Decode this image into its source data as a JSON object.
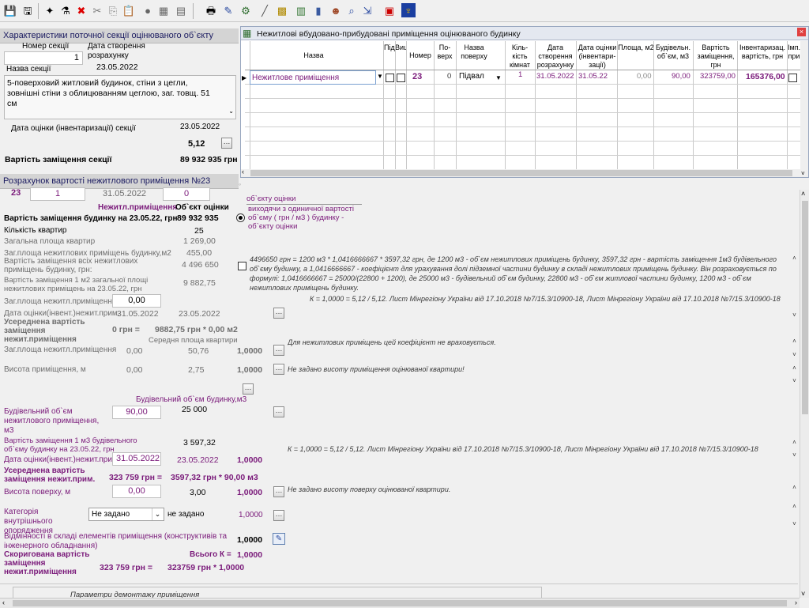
{
  "toolbar": {
    "icons": [
      "save-icon",
      "save-as-icon",
      "new-icon",
      "filter-icon",
      "delete-icon",
      "cut-icon",
      "copy-icon",
      "paste-icon",
      "circle-icon",
      "grid-icon",
      "dots-icon",
      "print-icon",
      "edit-icon",
      "settings-icon",
      "pen-icon",
      "calculator-icon",
      "report-icon",
      "chart-icon",
      "people-icon",
      "search-icon",
      "export-icon",
      "close-icon",
      "emblem-icon"
    ]
  },
  "section": {
    "header": "Характеристики поточної секції оцінюваного об`єкту",
    "number_label": "Номер секції",
    "number_value": "1",
    "name_label": "Назва секції",
    "created_label": "Дата створення розрахунку",
    "created_value": "23.05.2022",
    "description": "5-поверховий житловий будинок, стіни з цегли, зовнішні стіни з облицюванням цеглою, заг. товщ. 51 см",
    "eval_date_label": "Дата оцінки (інвентаризації) секції",
    "eval_date_value": "23.05.2022",
    "coef_value": "5,12",
    "replace_cost_label": "Вартість заміщення секції",
    "replace_cost_value": "89 932 935 грн"
  },
  "calc": {
    "header": "Розрахунок вартості нежитлового приміщення №23",
    "row1": [
      "23",
      "1",
      "31.05.2022",
      "0"
    ],
    "col_nonres": "Нежитл.приміщення",
    "col_object": "Об`єкт оцінки",
    "bld_cost_label": "Вартість заміщення будинку на 23.05.22, грн",
    "bld_cost_value": "89 932 935",
    "apt_count_label": "Кількість квартир",
    "apt_count_value": "25",
    "total_area_label": "Загальна площа квартир",
    "total_area_value": "1 269,00",
    "nonres_area_label": "Заг.площа нежитлових приміщень будинку,м2",
    "nonres_area_value": "455,00",
    "nonres_cost_label": "Вартість заміщення всіх нежитлових приміщень будинку, грн:",
    "nonres_cost_value": "4 496 650",
    "m2_cost_label": "Вартість заміщення 1 м2 загальної площі нежитлових приміщень на 23.05.22, грн",
    "m2_cost_value": "9 882,75",
    "area_label": "Заг.площа нежитл.приміщення",
    "area_value": "0,00",
    "date_label": "Дата оцінки(інвент.)нежит.прим.",
    "date_a": "31.05.2022",
    "date_b": "23.05.2022",
    "avg_label": "Усереднена вартість заміщення нежит.приміщення",
    "avg_left": "0 грн =",
    "avg_formula": "9882,75 грн * 0,00 м2",
    "avg_apt_label": "Середня площа квартири",
    "area2_label": "Заг.площа нежитл.приміщення",
    "area2_a": "0,00",
    "area2_b": "50,76",
    "area2_k": "1,0000",
    "height_label": "Висота приміщення, м",
    "height_a": "0,00",
    "height_b": "2,75",
    "height_k": "1,0000",
    "bld_volume_label": "Будівельний об`єм будинку,м3",
    "bld_volume_value": "25 000",
    "room_volume_label": "Будівельний об`єм нежитлового приміщення, м3",
    "room_volume_value": "90,00",
    "m3_cost_label": "Вартість заміщення 1 м3 будівельного об`єму будинку на 23.05.22, грн",
    "m3_cost_value": "3 597,32",
    "date2_label": "Дата оцінки(інвент.)нежит.прим.",
    "date2_a": "31.05.2022",
    "date2_b": "23.05.2022",
    "date2_k": "1,0000",
    "avg2_label": "Усереднена вартість заміщення нежит.прим.",
    "avg2_left": "323 759 грн =",
    "avg2_formula": "3597,32 грн * 90,00 м3",
    "floor_label": "Висота поверху, м",
    "floor_a": "0,00",
    "floor_b": "3,00",
    "floor_k": "1,0000",
    "cat_label": "Категорія внутрішнього опорядження",
    "cat_value": "Не задано",
    "cat_b": "не задано",
    "cat_k": "1,0000",
    "diff_label": "Відмінності в складі елементів приміщення (конструктивів та інженерного обладнання)",
    "diff_k": "1,0000",
    "total_k_label": "Всього К =",
    "total_k_value": "1,0000",
    "adj_label": "Скоригована вартість заміщення нежит.приміщення",
    "adj_left": "323 759 грн =",
    "adj_formula": "323759 грн * 1,0000",
    "bottom_label": "Параметри  демонтажу  приміщення"
  },
  "table": {
    "title": "Нежитлові вбудовано-прибудовані приміщення оцінюваного будинку",
    "columns": [
      "Назва",
      "ПідВал",
      "Вищ.0,0",
      "Номер",
      "По-верх",
      "Назва поверху",
      "Кіль-кість кімнат",
      "Дата створення розрахунку",
      "Дата оцінки (інвентари-зації)",
      "Площа, м2",
      "Будівельн. об`єм, м3",
      "Вартість заміщення, грн",
      "Інвентаризац. вартість, грн",
      "Імп. при"
    ],
    "row": {
      "name": "Нежитлове приміщення",
      "number": "23",
      "floor": "0",
      "floor_name": "Підвал",
      "rooms": "1",
      "created": "31.05.2022",
      "evaluated": "31.05.22",
      "area": "0,00",
      "volume": "90,00",
      "cost": "323759,00",
      "inv_cost": "165376,00"
    }
  },
  "radio": {
    "option1": "об`єкту оцінки",
    "option2": "виходячи з одиничної вартості об`єму ( грн / м3 ) будинку - об`єкту оцінки"
  },
  "notes": {
    "n1": "4496650 грн = 1200 м3 * 1,0416666667 * 3597,32 грн, де 1200 м3 - об`єм нежитлових приміщень будинку, 3597,32 грн - вартість заміщення 1м3 будівельного об`єму будинку, а 1,0416666667 - коефіцієнт для урахування долі підземної частини будинку в складі нежитлових приміщень будинку. Він розраховується по формулі: 1,0416666667 = 25000/(22800 + 1200), де 25000 м3 - будівельний об`єм будинку, 22800 м3 - об`єм житлової частини будинку, 1200 м3 - об`єм нежитлових приміщень будинку.",
    "n2": "К = 1,0000 = 5,12 / 5,12. Лист Мінрегіону України від 17.10.2018 №7/15.3/10900-18, Лист Мінрегіону України від 17.10.2018 №7/15.3/10900-18",
    "n3": "Для нежитлових приміщень цей коефіцієнт не враховується.",
    "n4": "Не задано висоту приміщення оцінюваної квартири!",
    "n5": "К = 1,0000 = 5,12 / 5,12. Лист Мінрегіону України від 17.10.2018 №7/15.3/10900-18, Лист Мінрегіону України від 17.10.2018 №7/15.3/10900-18",
    "n6": "Не задано висоту поверху оцінюваної квартири."
  }
}
